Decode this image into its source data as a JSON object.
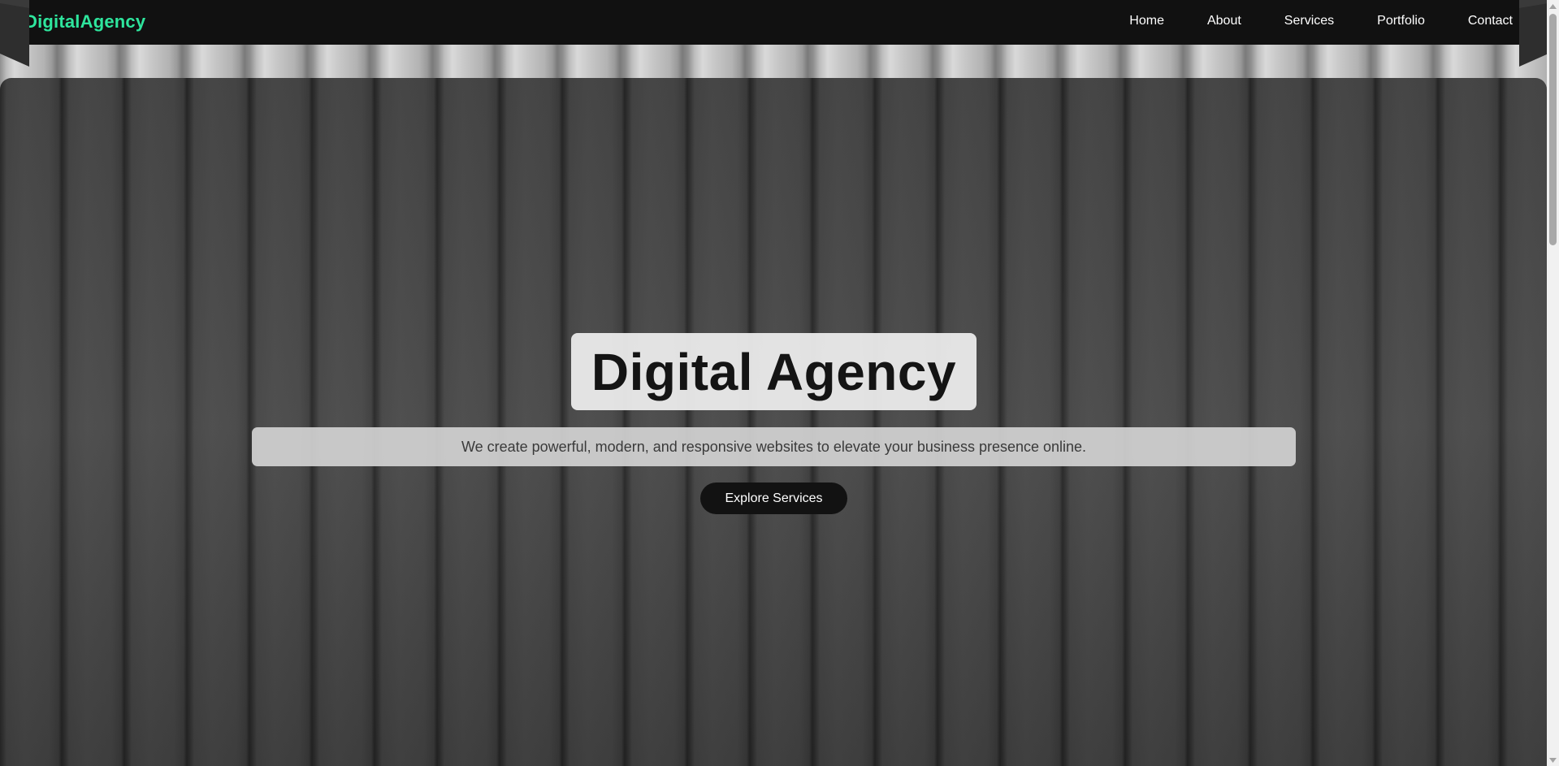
{
  "header": {
    "logo": "DigitalAgency",
    "nav": [
      {
        "label": "Home"
      },
      {
        "label": "About"
      },
      {
        "label": "Services"
      },
      {
        "label": "Portfolio"
      },
      {
        "label": "Contact"
      }
    ]
  },
  "hero": {
    "title": "Digital Agency",
    "subtitle": "We create powerful, modern, and responsive websites to elevate your business presence online.",
    "cta_label": "Explore Services"
  },
  "colors": {
    "logo_accent": "#2ee59d",
    "header_bg": "#111111",
    "button_bg": "#121212"
  },
  "icons": {
    "scroll_up": "triangle-up-icon",
    "scroll_down": "triangle-down-icon",
    "ribbon": "corner-ribbon"
  }
}
